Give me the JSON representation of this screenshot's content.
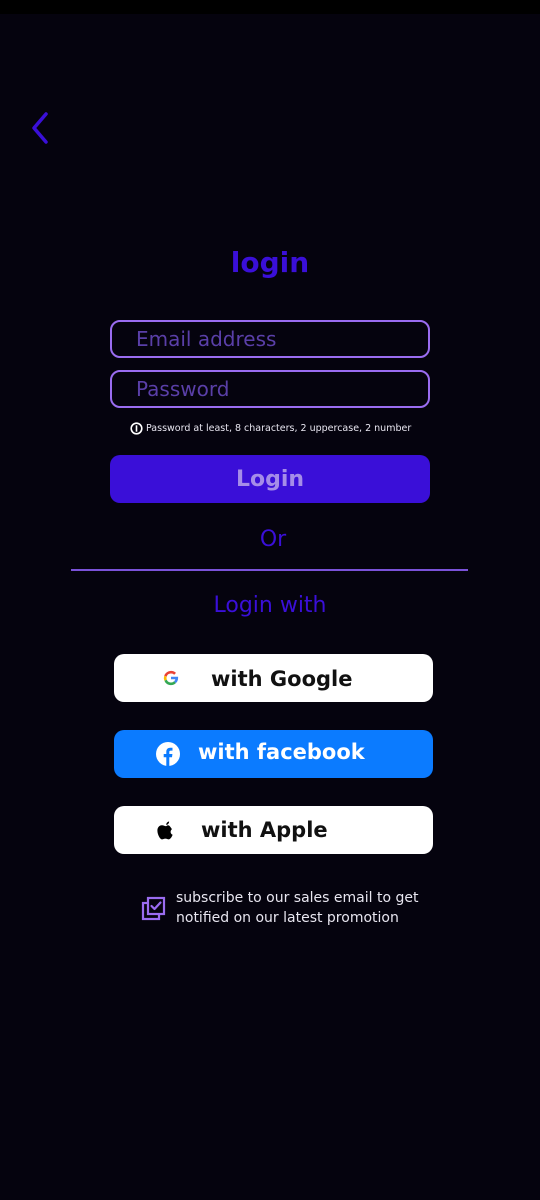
{
  "header": {
    "back_icon": "chevron-left-icon",
    "title": "login"
  },
  "form": {
    "email_placeholder": "Email address",
    "password_placeholder": "Password",
    "password_hint": "Password at least, 8 characters, 2 uppercase, 2 number",
    "login_label": "Login"
  },
  "separator": {
    "or_text": "Or",
    "login_with_text": "Login with"
  },
  "social": {
    "google_label": "with Google",
    "facebook_label": "with facebook",
    "apple_label": "with Apple"
  },
  "subscribe": {
    "text": "subscribe to our sales email to get notified on our latest promotion"
  },
  "colors": {
    "background": "#05030e",
    "accent": "#3a0fd8",
    "field_border": "#9a6cf0",
    "facebook_blue": "#0b7bff"
  }
}
